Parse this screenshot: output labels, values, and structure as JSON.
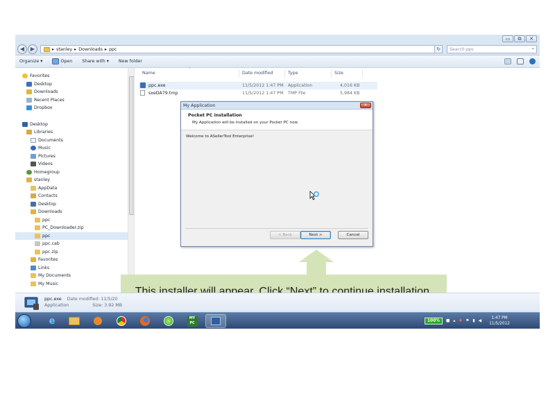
{
  "window": {
    "controls": [
      "▭",
      "⧉",
      "✕"
    ]
  },
  "address": {
    "crumbs": [
      "stanley",
      "Downloads",
      "ppc"
    ],
    "search_placeholder": "Search ppc"
  },
  "toolbar": {
    "organize": "Organize ▾",
    "open": "Open",
    "share": "Share with ▾",
    "new_folder": "New folder"
  },
  "nav": {
    "favorites": "Favorites",
    "desktop": "Desktop",
    "downloads": "Downloads",
    "recent": "Recent Places",
    "dropbox": "Dropbox",
    "desktop2": "Desktop",
    "libraries": "Libraries",
    "documents": "Documents",
    "music": "Music",
    "pictures": "Pictures",
    "videos": "Videos",
    "homegroup": "Homegroup",
    "stanley": "stanley",
    "appdata": "AppData",
    "contacts": "Contacts",
    "desktop3": "Desktop",
    "downloads2": "Downloads",
    "ppc1": "ppc",
    "pcdl": "PC_Downloader.zip",
    "ppc2": "ppc",
    "ppccab": "ppc.cab",
    "ppczip": "ppc.zip",
    "favorites2": "Favorites",
    "links": "Links",
    "mydocs": "My Documents",
    "mymusic": "My Music"
  },
  "files": {
    "headers": {
      "name": "Name",
      "date": "Date modified",
      "type": "Type",
      "size": "Size"
    },
    "rows": [
      {
        "name": "ppc.exe",
        "date": "11/5/2012 1:47 PM",
        "type": "Application",
        "size": "4,016 KB"
      },
      {
        "name": "sxeDA79.tmp",
        "date": "11/5/2012 1:47 PM",
        "type": "TMP File",
        "size": "5,984 KB"
      }
    ]
  },
  "dialog": {
    "title": "My Application",
    "close": "✕",
    "heading": "Pocket PC installation",
    "subheading": "My Application will be installed on your Pocket PC now",
    "body": "Welcome to ASellerTool Enterprise!",
    "back": "< Back",
    "next": "Next >",
    "cancel": "Cancel"
  },
  "details": {
    "name": "ppc.exe",
    "date_label": "Date modified: 11/5/20",
    "type": "Application",
    "size_label": "Size: 3.92 MB"
  },
  "callout": {
    "text": "This installer will appear. Click “Next” to continue installation."
  },
  "tray": {
    "battery": "100%",
    "time": "1:47 PM",
    "date": "11/5/2012"
  },
  "colors": {
    "callout_bg": "#d5e4b8",
    "taskbar": "#2d4a75",
    "selection": "#dbe9f8"
  }
}
